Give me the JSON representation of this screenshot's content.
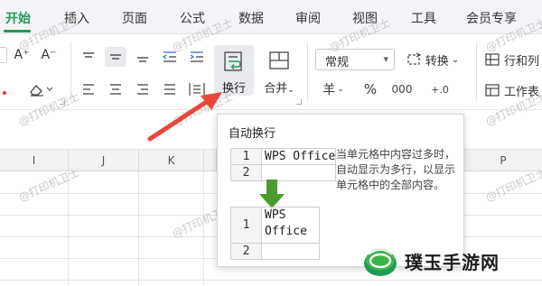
{
  "tabs": [
    {
      "label": "开始",
      "active": true
    },
    {
      "label": "插入"
    },
    {
      "label": "页面"
    },
    {
      "label": "公式"
    },
    {
      "label": "数据"
    },
    {
      "label": "审阅"
    },
    {
      "label": "视图"
    },
    {
      "label": "工具"
    },
    {
      "label": "会员专享"
    }
  ],
  "ribbon": {
    "wrap_text_label": "换行",
    "merge_label": "合并",
    "number_format_value": "常规",
    "convert_label": "转换",
    "rows_cols_label": "行和列",
    "worksheet_label": "工作表",
    "currency_symbol": "羊",
    "percent_symbol": "%",
    "font_grow": "A⁺",
    "font_shrink": "A⁻"
  },
  "columns": [
    "I",
    "J",
    "K",
    "P"
  ],
  "tooltip": {
    "title": "自动换行",
    "description": "当单元格中内容过多时，自动显示为多行，以显示单元格中的全部内容。",
    "example_before": {
      "row1": "1",
      "row2": "2",
      "cell": "WPS Office"
    },
    "example_after": {
      "row1": "1",
      "row2": "2",
      "line1": "WPS",
      "line2": "Office"
    }
  },
  "watermark_text": "@打印机卫士",
  "brand": {
    "name": "璞玉手游网",
    "colors": {
      "primary": "#1f9a57",
      "accent": "#3ab54a"
    }
  },
  "colors": {
    "accent_green": "#1f9a57",
    "arrow_red": "#e8473b",
    "arrow_green": "#4a9a2e"
  }
}
